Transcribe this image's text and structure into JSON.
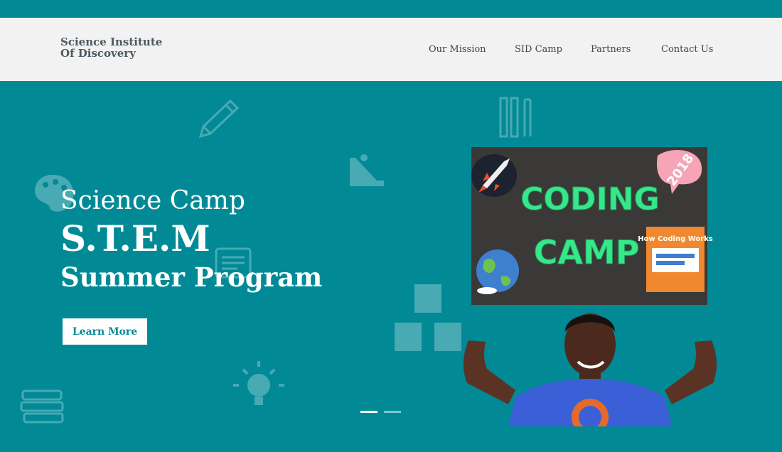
{
  "brand": {
    "line1": "Science Institute",
    "line2": "Of Discovery"
  },
  "nav": [
    "Our Mission",
    "SID Camp",
    "Partners",
    "Contact Us"
  ],
  "hero": {
    "line1": "Science Camp",
    "line2": "S.T.E.M",
    "line3": "Summer Program",
    "cta": "Learn More"
  },
  "sign": {
    "title1": "CODING",
    "title2": "CAMP",
    "year": "2018",
    "book_title": "How Coding Works"
  },
  "slider": {
    "slides": 2,
    "active": 1
  },
  "colors": {
    "teal": "#018a96",
    "nav_bg": "#f2f2f2",
    "sign_text": "#35e88a",
    "shirt": "#3b5fd6"
  },
  "icons": [
    "pencil-icon",
    "palette-icon",
    "ruler-tools-icon",
    "slide-playground-icon",
    "document-icon",
    "abc-blocks-icon",
    "lightbulb-icon",
    "books-icon"
  ]
}
